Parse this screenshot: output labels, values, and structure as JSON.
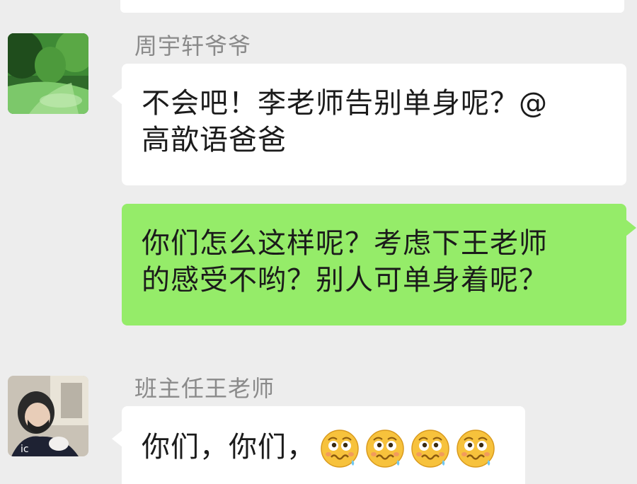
{
  "messages": [
    {
      "sender": "周宇轩爷爷",
      "direction": "incoming",
      "avatar_icon": "green-landscape-avatar",
      "lines": [
        "不会吧！李老师告别单身呢？@",
        "高歆语爸爸"
      ]
    },
    {
      "direction": "outgoing",
      "lines": [
        "你们怎么这样呢？考虑下王老师",
        "的感受不哟？别人可单身着呢？"
      ]
    },
    {
      "sender": "班主任王老师",
      "direction": "incoming",
      "avatar_icon": "masked-person-avatar",
      "text": "你们，你们，",
      "emoji_icon": "woozy-sweat-face-emoji",
      "emoji_count": 4
    }
  ],
  "colors": {
    "background": "#ededed",
    "incoming_bubble": "#ffffff",
    "outgoing_bubble": "#95ec69",
    "sender_name": "#8a8a8a"
  }
}
